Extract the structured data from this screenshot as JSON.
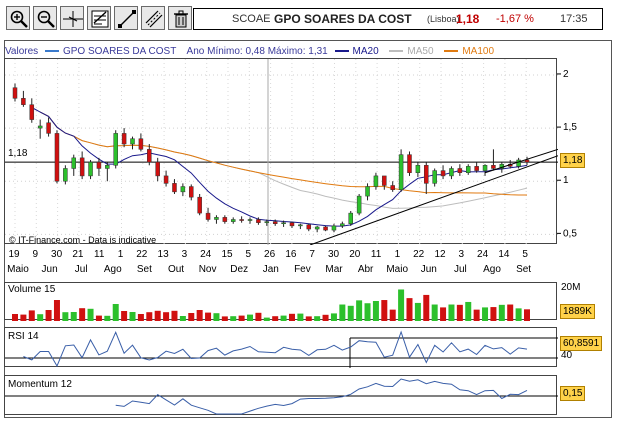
{
  "toolbar": {
    "tools": [
      {
        "name": "zoom-in-tool",
        "icon": "zoom-in-icon"
      },
      {
        "name": "zoom-out-tool",
        "icon": "zoom-out-icon"
      },
      {
        "name": "crosshair-tool",
        "icon": "crosshair-icon"
      },
      {
        "name": "indicators-tool",
        "icon": "indicators-icon"
      },
      {
        "name": "trendline-tool",
        "icon": "trendline-icon"
      },
      {
        "name": "channel-tool",
        "icon": "channel-icon"
      },
      {
        "name": "delete-tool",
        "icon": "trash-icon"
      }
    ]
  },
  "quote": {
    "symbol": "SCOAE",
    "name": "GPO SOARES DA COST",
    "exchange": "(Lisboa)",
    "price": "1,18",
    "change": "-1,67 %",
    "time": "17:35"
  },
  "main": {
    "legend": {
      "values_label": "Valores",
      "series_name": "GPO SOARES DA COST",
      "range_text": "Ano Mínimo: 0,48 Máximo: 1,31",
      "ma20": "MA20",
      "ma50": "MA50",
      "ma100": "MA100"
    },
    "current_price_label": "1,18",
    "current_price_box": "1,18",
    "credit": "© IT-Finance.com - Data is indicative",
    "colors": {
      "ma20": "#1a1a8c",
      "ma50": "#bdbdbd",
      "ma100": "#e07a10",
      "up": "#2cc02c",
      "down": "#d01010"
    }
  },
  "volume": {
    "label": "Volume 15",
    "scale_top": "20M",
    "value_box": "1889K"
  },
  "rsi": {
    "label": "RSI 14",
    "value_box": "60,8591",
    "level": "40"
  },
  "momentum": {
    "label": "Momentum 12",
    "value_box": "0,15"
  },
  "chart_data": {
    "type": "candlestick",
    "y_ticks": [
      "2",
      "1,5",
      "1",
      "0,5"
    ],
    "ylim": [
      0.4,
      2.15
    ],
    "x_day_labels": [
      "19",
      "9",
      "30",
      "21",
      "11",
      "1",
      "22",
      "13",
      "3",
      "24",
      "15",
      "5",
      "26",
      "16",
      "7",
      "30",
      "20",
      "11",
      "1",
      "22",
      "12",
      "3",
      "24",
      "14",
      "5"
    ],
    "x_month_labels": [
      "Maio",
      "Jun",
      "Jul",
      "Ago",
      "Set",
      "Out",
      "Nov",
      "Dez",
      "Jan",
      "Fev",
      "Mar",
      "Abr",
      "Maio",
      "Jun",
      "Jul",
      "Ago",
      "Set"
    ],
    "candles": [
      {
        "o": 1.88,
        "h": 1.92,
        "l": 1.75,
        "c": 1.78
      },
      {
        "o": 1.78,
        "h": 1.85,
        "l": 1.7,
        "c": 1.72
      },
      {
        "o": 1.72,
        "h": 1.78,
        "l": 1.55,
        "c": 1.58
      },
      {
        "o": 1.5,
        "h": 1.58,
        "l": 1.4,
        "c": 1.52
      },
      {
        "o": 1.55,
        "h": 1.6,
        "l": 1.42,
        "c": 1.45
      },
      {
        "o": 1.45,
        "h": 1.48,
        "l": 0.98,
        "c": 1.0
      },
      {
        "o": 1.0,
        "h": 1.15,
        "l": 0.97,
        "c": 1.12
      },
      {
        "o": 1.12,
        "h": 1.25,
        "l": 1.05,
        "c": 1.22
      },
      {
        "o": 1.22,
        "h": 1.28,
        "l": 1.02,
        "c": 1.05
      },
      {
        "o": 1.05,
        "h": 1.2,
        "l": 1.02,
        "c": 1.18
      },
      {
        "o": 1.18,
        "h": 1.22,
        "l": 1.05,
        "c": 1.12
      },
      {
        "o": 1.12,
        "h": 1.18,
        "l": 1.0,
        "c": 1.15
      },
      {
        "o": 1.15,
        "h": 1.48,
        "l": 1.12,
        "c": 1.45
      },
      {
        "o": 1.45,
        "h": 1.5,
        "l": 1.32,
        "c": 1.35
      },
      {
        "o": 1.35,
        "h": 1.42,
        "l": 1.3,
        "c": 1.4
      },
      {
        "o": 1.4,
        "h": 1.45,
        "l": 1.28,
        "c": 1.3
      },
      {
        "o": 1.3,
        "h": 1.35,
        "l": 1.15,
        "c": 1.18
      },
      {
        "o": 1.18,
        "h": 1.22,
        "l": 1.0,
        "c": 1.05
      },
      {
        "o": 1.05,
        "h": 1.1,
        "l": 0.95,
        "c": 0.98
      },
      {
        "o": 0.98,
        "h": 1.02,
        "l": 0.88,
        "c": 0.9
      },
      {
        "o": 0.9,
        "h": 0.98,
        "l": 0.86,
        "c": 0.95
      },
      {
        "o": 0.95,
        "h": 0.97,
        "l": 0.82,
        "c": 0.85
      },
      {
        "o": 0.85,
        "h": 0.88,
        "l": 0.68,
        "c": 0.7
      },
      {
        "o": 0.7,
        "h": 0.75,
        "l": 0.62,
        "c": 0.64
      },
      {
        "o": 0.64,
        "h": 0.68,
        "l": 0.6,
        "c": 0.66
      },
      {
        "o": 0.66,
        "h": 0.68,
        "l": 0.6,
        "c": 0.62
      },
      {
        "o": 0.62,
        "h": 0.66,
        "l": 0.6,
        "c": 0.64
      },
      {
        "o": 0.64,
        "h": 0.67,
        "l": 0.61,
        "c": 0.63
      },
      {
        "o": 0.63,
        "h": 0.66,
        "l": 0.6,
        "c": 0.64
      },
      {
        "o": 0.64,
        "h": 0.66,
        "l": 0.59,
        "c": 0.61
      },
      {
        "o": 0.61,
        "h": 0.64,
        "l": 0.58,
        "c": 0.62
      },
      {
        "o": 0.62,
        "h": 0.64,
        "l": 0.58,
        "c": 0.6
      },
      {
        "o": 0.6,
        "h": 0.63,
        "l": 0.57,
        "c": 0.61
      },
      {
        "o": 0.61,
        "h": 0.62,
        "l": 0.56,
        "c": 0.58
      },
      {
        "o": 0.58,
        "h": 0.6,
        "l": 0.55,
        "c": 0.59
      },
      {
        "o": 0.59,
        "h": 0.6,
        "l": 0.53,
        "c": 0.55
      },
      {
        "o": 0.55,
        "h": 0.58,
        "l": 0.52,
        "c": 0.57
      },
      {
        "o": 0.57,
        "h": 0.58,
        "l": 0.53,
        "c": 0.54
      },
      {
        "o": 0.54,
        "h": 0.6,
        "l": 0.52,
        "c": 0.58
      },
      {
        "o": 0.58,
        "h": 0.62,
        "l": 0.56,
        "c": 0.6
      },
      {
        "o": 0.6,
        "h": 0.72,
        "l": 0.58,
        "c": 0.7
      },
      {
        "o": 0.7,
        "h": 0.88,
        "l": 0.68,
        "c": 0.86
      },
      {
        "o": 0.86,
        "h": 0.98,
        "l": 0.82,
        "c": 0.95
      },
      {
        "o": 0.95,
        "h": 1.08,
        "l": 0.92,
        "c": 1.05
      },
      {
        "o": 1.05,
        "h": 1.02,
        "l": 0.92,
        "c": 0.96
      },
      {
        "o": 0.96,
        "h": 1.0,
        "l": 0.9,
        "c": 0.92
      },
      {
        "o": 0.92,
        "h": 1.3,
        "l": 0.9,
        "c": 1.25
      },
      {
        "o": 1.25,
        "h": 1.28,
        "l": 1.05,
        "c": 1.08
      },
      {
        "o": 1.08,
        "h": 1.18,
        "l": 1.04,
        "c": 1.15
      },
      {
        "o": 1.15,
        "h": 1.18,
        "l": 0.88,
        "c": 0.98
      },
      {
        "o": 0.98,
        "h": 1.12,
        "l": 0.95,
        "c": 1.1
      },
      {
        "o": 1.1,
        "h": 1.15,
        "l": 1.02,
        "c": 1.05
      },
      {
        "o": 1.05,
        "h": 1.14,
        "l": 1.02,
        "c": 1.12
      },
      {
        "o": 1.12,
        "h": 1.16,
        "l": 1.05,
        "c": 1.08
      },
      {
        "o": 1.08,
        "h": 1.16,
        "l": 1.06,
        "c": 1.14
      },
      {
        "o": 1.14,
        "h": 1.18,
        "l": 1.08,
        "c": 1.1
      },
      {
        "o": 1.1,
        "h": 1.16,
        "l": 1.05,
        "c": 1.15
      },
      {
        "o": 1.15,
        "h": 1.3,
        "l": 1.1,
        "c": 1.12
      },
      {
        "o": 1.12,
        "h": 1.18,
        "l": 1.08,
        "c": 1.16
      },
      {
        "o": 1.16,
        "h": 1.2,
        "l": 1.12,
        "c": 1.14
      },
      {
        "o": 1.14,
        "h": 1.22,
        "l": 1.12,
        "c": 1.2
      },
      {
        "o": 1.2,
        "h": 1.23,
        "l": 1.15,
        "c": 1.18
      }
    ]
  }
}
